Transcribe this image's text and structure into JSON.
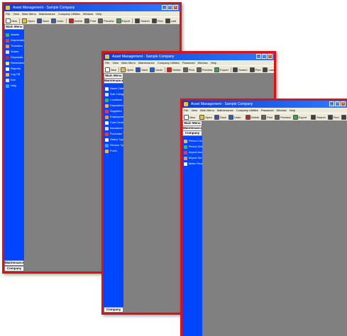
{
  "title": "Asset Management - Sample Company",
  "window_buttons": {
    "min": "_",
    "max": "□",
    "close": "x"
  },
  "menus_a": [
    "File",
    "View",
    "Main Menu",
    "Maintenance",
    "Company Utilities",
    "Window",
    "Help"
  ],
  "menus_b": [
    "File",
    "View",
    "Main Menu",
    "Maintenance",
    "Company Utilities",
    "Password",
    "Window",
    "Help"
  ],
  "toolbar": [
    {
      "label": "New",
      "color": "#ffffff"
    },
    {
      "label": "Open",
      "color": "#e8c040"
    },
    {
      "label": "Save",
      "color": "#3050c0"
    },
    {
      "label": "Undo",
      "color": "#2060d0"
    },
    {
      "label": "Delete",
      "color": "#d02020"
    },
    {
      "label": "Print",
      "color": "#606060"
    },
    {
      "label": "Preview",
      "color": "#606060"
    },
    {
      "label": "Export",
      "color": "#40a040"
    },
    {
      "label": "Search",
      "color": "#404040"
    },
    {
      "label": "Find",
      "color": "#404040"
    },
    {
      "label": "Last",
      "color": "#404040"
    }
  ],
  "colors": {
    "sidebar": "#0046ff",
    "border": "#e01010",
    "content": "#808080"
  },
  "win1": {
    "headers_top": [
      "Main Menu"
    ],
    "nav": [
      {
        "label": "Assets",
        "icon": "asset-icon",
        "color": "#40c040"
      },
      {
        "label": "Depreciation",
        "icon": "depreciation-icon",
        "color": "#e04040"
      },
      {
        "label": "Transfers",
        "icon": "transfer-icon",
        "color": "#f0a020"
      },
      {
        "label": "Scans",
        "icon": "scan-icon",
        "color": "#e0e0e0"
      },
      {
        "label": "Disposals",
        "icon": "disposal-icon",
        "color": "#c03030"
      },
      {
        "label": "Reminders",
        "icon": "reminder-icon",
        "color": "#f0f040"
      },
      {
        "label": "Reports",
        "icon": "report-icon",
        "color": "#ffffff"
      },
      {
        "label": "Log Off",
        "icon": "logoff-icon",
        "color": "#f0c020"
      },
      {
        "label": "Exit",
        "icon": "exit-icon",
        "color": "#e0e0e0"
      },
      {
        "label": "Help",
        "icon": "help-icon",
        "color": "#40a0ff"
      }
    ],
    "headers_bottom": [
      "Maintenance",
      "Company Utilities"
    ]
  },
  "win2": {
    "headers_top": [
      "Main Menu",
      "Maintenance"
    ],
    "nav": [
      {
        "label": "Asset Categories",
        "icon": "category-icon",
        "color": "#ffffff"
      },
      {
        "label": "Sub Categories",
        "icon": "subcategory-icon",
        "color": "#e0e0e0"
      },
      {
        "label": "Locations",
        "icon": "location-icon",
        "color": "#40c040"
      },
      {
        "label": "Departments",
        "icon": "department-icon",
        "color": "#f0c020"
      },
      {
        "label": "Suppliers",
        "icon": "supplier-icon",
        "color": "#e04040"
      },
      {
        "label": "Employees",
        "icon": "employee-icon",
        "color": "#f0a020"
      },
      {
        "label": "Cost Centres",
        "icon": "costcentre-icon",
        "color": "#ffffff"
      },
      {
        "label": "Insurance Cos.",
        "icon": "insurance-icon",
        "color": "#e0e0e0"
      },
      {
        "label": "Purchase Types",
        "icon": "purchase-icon",
        "color": "#e04040"
      },
      {
        "label": "Status Types",
        "icon": "status-icon",
        "color": "#ffffff"
      },
      {
        "label": "Service Type",
        "icon": "service-icon",
        "color": "#40a0ff"
      },
      {
        "label": "Fuels",
        "icon": "fuel-icon",
        "color": "#f0c020"
      }
    ],
    "headers_bottom": [
      "Company Utilities"
    ]
  },
  "win3": {
    "headers_top": [
      "Main Menu",
      "Maintenance",
      "Company Utilities"
    ],
    "nav": [
      {
        "label": "Period Close",
        "icon": "period-close-icon",
        "color": "#f0c020"
      },
      {
        "label": "Period Setup",
        "icon": "period-setup-icon",
        "color": "#40c040"
      },
      {
        "label": "Import Assets",
        "icon": "import-icon",
        "color": "#e04040"
      },
      {
        "label": "Import Services",
        "icon": "import-services-icon",
        "color": "#f0a020"
      },
      {
        "label": "Meter Readings",
        "icon": "meter-icon",
        "color": "#ffffff"
      }
    ],
    "headers_bottom": []
  }
}
